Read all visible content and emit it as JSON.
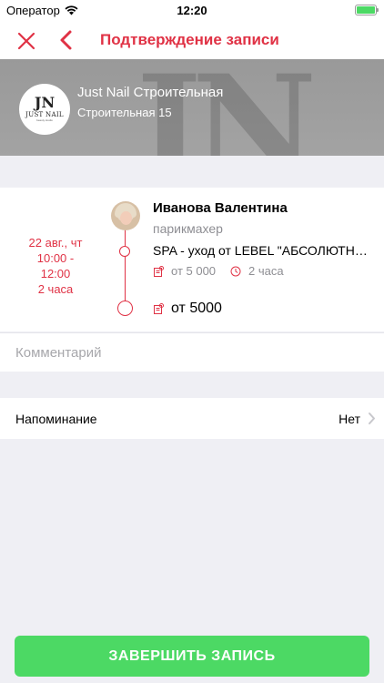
{
  "status_bar": {
    "carrier": "Оператор",
    "time": "12:20",
    "battery_level": 1.0
  },
  "nav": {
    "title": "Подтверждение записи",
    "close_icon": "close-icon",
    "back_icon": "chevron-left-icon",
    "accent_color": "#e03245"
  },
  "salon": {
    "name": "Just Nail Строительная",
    "address": "Строительная 15",
    "logo_mark": "JN",
    "logo_text": "JUST NAIL",
    "logo_sub": "beauty studio"
  },
  "booking": {
    "date": "22 авг., чт",
    "time_start": "10:00 -",
    "time_end": "12:00",
    "duration": "2 часа",
    "master_name": "Иванова Валентина",
    "master_role": "парикмахер",
    "service_name": "SPA - уход от LEBEL \"АБСОЛЮТНОЕ СЧАСТЬЕ\"",
    "service_price": "от 5 000",
    "service_duration": "2 часа",
    "total": "от 5000"
  },
  "comment": {
    "placeholder": "Комментарий"
  },
  "reminder": {
    "label": "Напоминание",
    "value": "Нет"
  },
  "submit": {
    "label": "ЗАВЕРШИТЬ ЗАПИСЬ",
    "color": "#4cd964"
  }
}
